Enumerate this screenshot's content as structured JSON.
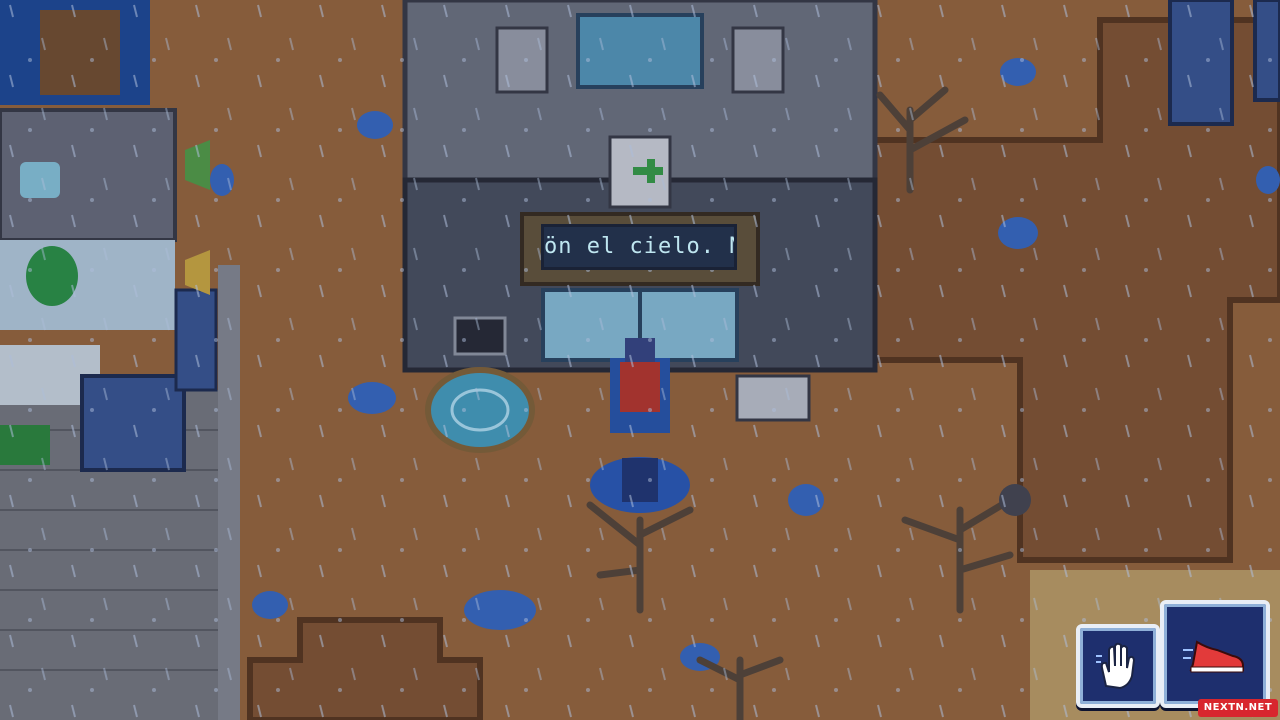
{
  "game": {
    "building_sign_text": "ön el cielo. No !",
    "controls": {
      "interact_button": {
        "icon": "hand-icon"
      },
      "run_button": {
        "icon": "sneaker-icon"
      }
    },
    "watermark": "NEXTN.NET",
    "colors": {
      "ground": "#a06c3e",
      "water": "#1f4e9e",
      "building_wall": "#5b6373",
      "button_face": "#1e2f6e",
      "rain": "#cfe2ff"
    }
  }
}
